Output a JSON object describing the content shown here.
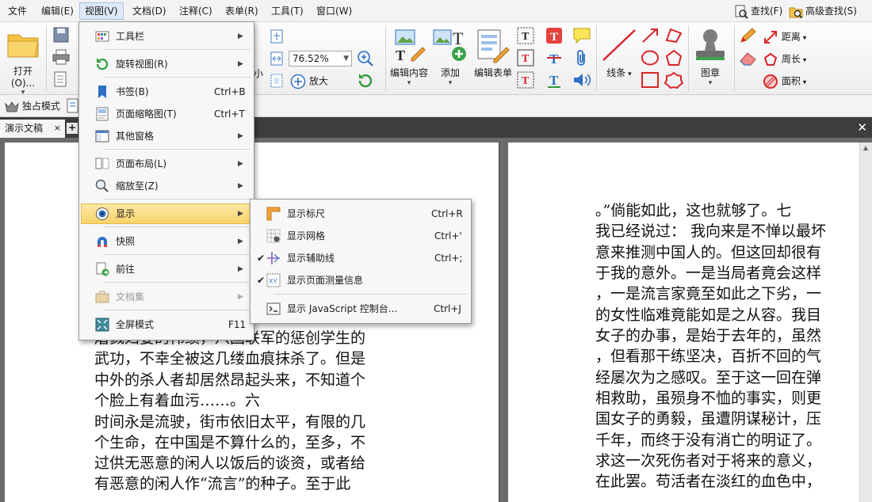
{
  "menubar": {
    "items": [
      "文件",
      "编辑(E)",
      "视图(V)",
      "文档(D)",
      "注释(C)",
      "表单(R)",
      "工具(T)",
      "窗口(W)"
    ],
    "search": "查找(F)",
    "advanced_search": "高级查找(S)"
  },
  "ribbon": {
    "open": "打开(O)...",
    "zoom_value": "76.52%",
    "zoom_in": "放大",
    "zoom_out": "缩小",
    "partial_label": "小",
    "edit_content": "编辑内容",
    "add": "添加",
    "edit_form": "编辑表单",
    "lines": "线条",
    "stamp": "图章",
    "distance": "距离",
    "perimeter": "周长",
    "area": "面积"
  },
  "row2": {
    "exclusive_mode": "独占模式"
  },
  "tabs": {
    "active": "演示文稿",
    "close": "×",
    "new": "+"
  },
  "view_menu": {
    "items": [
      {
        "label": "工具栏",
        "shortcut": "",
        "submenu": true
      },
      {
        "label": "旋转视图(R)",
        "shortcut": "",
        "submenu": true
      },
      {
        "label": "书签(B)",
        "shortcut": "Ctrl+B",
        "submenu": false
      },
      {
        "label": "页面缩略图(T)",
        "shortcut": "Ctrl+T",
        "submenu": false
      },
      {
        "label": "其他窗格",
        "shortcut": "",
        "submenu": true
      },
      {
        "label": "页面布局(L)",
        "shortcut": "",
        "submenu": true
      },
      {
        "label": "缩放至(Z)",
        "shortcut": "",
        "submenu": true
      },
      {
        "label": "显示",
        "shortcut": "",
        "submenu": true
      },
      {
        "label": "快照",
        "shortcut": "",
        "submenu": true
      },
      {
        "label": "前往",
        "shortcut": "",
        "submenu": true
      },
      {
        "label": "文档集",
        "shortcut": "",
        "submenu": true
      },
      {
        "label": "全屏模式",
        "shortcut": "F11",
        "submenu": false
      }
    ]
  },
  "show_submenu": {
    "items": [
      {
        "label": "显示标尺",
        "shortcut": "Ctrl+R",
        "checked": false
      },
      {
        "label": "显示网格",
        "shortcut": "Ctrl+'",
        "checked": false
      },
      {
        "label": "显示辅助线",
        "shortcut": "Ctrl+;",
        "checked": true
      },
      {
        "label": "显示页面测量信息",
        "shortcut": "",
        "checked": true
      },
      {
        "label": "显示 JavaScript 控制台...",
        "shortcut": "Ctrl+J",
        "checked": false
      }
    ]
  },
  "document": {
    "left_lines": [
      "屠戮妇婴的伟绩，八国联军的惩创学生的",
      "武功，不幸全被这几缕血痕抹杀了。但是",
      "中外的杀人者却居然昂起头来，不知道个",
      "个脸上有着血污……。六",
      "时间永是流驶，街市依旧太平，有限的几",
      "个生命，在中国是不算什么的，至多，不",
      "过供无恶意的闲人以饭后的谈资，或者给",
      "有恶意的闲人作“流言”的种子。至于此"
    ],
    "right_lines": [
      "。”倘能如此，这也就够了。七",
      "我已经说过： 我向来是不惮以最坏",
      "意来推测中国人的。但这回却很有",
      "于我的意外。一是当局者竟会这样",
      "，一是流言家竟至如此之下劣，一",
      "的女性临难竟能如是之从容。我目",
      "女子的办事，是始于去年的，虽然",
      "，但看那干练坚决，百折不回的气",
      "经屡次为之感叹。至于这一回在弹",
      "相救助，虽殒身不恤的事实，则更",
      "国女子的勇毅，虽遭阴谋秘计，压",
      "千年，而终于没有消亡的明证了。",
      "求这一次死伤者对于将来的意义，",
      "在此罢。苟活者在淡红的血色中，"
    ]
  },
  "colors": {
    "accent_blue": "#2f6fc4",
    "highlight": "#f9d36a",
    "red_tool": "#d9252a"
  }
}
